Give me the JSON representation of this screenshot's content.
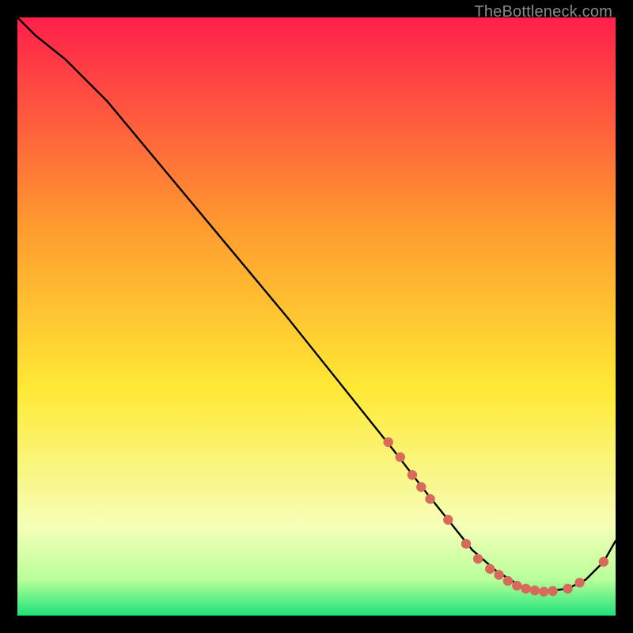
{
  "watermark": "TheBottleneck.com",
  "colors": {
    "gradient_top": "#ff1f4b",
    "gradient_mid_orange": "#ff9b2f",
    "gradient_yellow": "#ffe934",
    "gradient_pale": "#f6ffb8",
    "gradient_green": "#1ee27a",
    "curve_stroke": "#000000",
    "marker_fill": "#d86a5c"
  },
  "chart_data": {
    "type": "line",
    "title": "",
    "xlabel": "",
    "ylabel": "",
    "xlim": [
      0,
      100
    ],
    "ylim": [
      0,
      100
    ],
    "series": [
      {
        "name": "curve",
        "x": [
          0,
          3,
          8,
          15,
          25,
          35,
          45,
          55,
          63,
          68,
          72,
          76,
          80,
          84,
          88,
          92,
          95,
          98,
          100
        ],
        "y": [
          100,
          97,
          93,
          86,
          74,
          62,
          50,
          37.5,
          27.5,
          21,
          16,
          11,
          7.5,
          5,
          4,
          4.5,
          6,
          9,
          12.5
        ]
      }
    ],
    "markers": {
      "name": "dots",
      "x": [
        62,
        64,
        66,
        67.5,
        69,
        72,
        75,
        77,
        79,
        80.5,
        82,
        83.5,
        85,
        86.5,
        88,
        89.5,
        92,
        94,
        98
      ],
      "y": [
        29,
        26.5,
        23.5,
        21.5,
        19.5,
        16,
        12,
        9.5,
        7.8,
        6.8,
        5.8,
        5,
        4.5,
        4.2,
        4,
        4.1,
        4.5,
        5.5,
        9
      ]
    }
  }
}
